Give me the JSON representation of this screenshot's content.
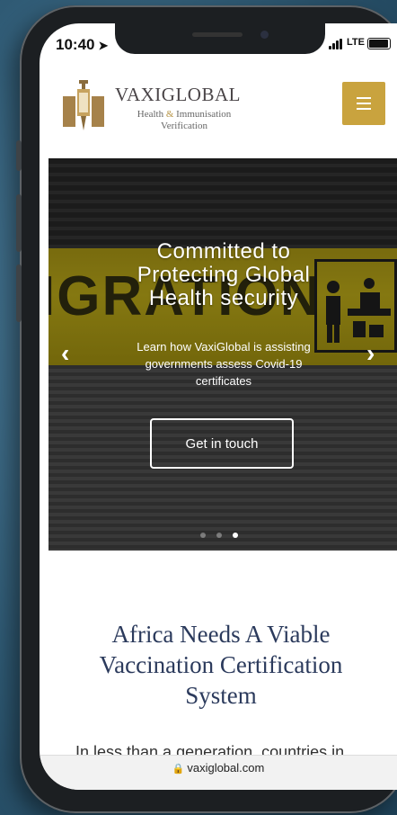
{
  "status_bar": {
    "time": "10:40",
    "network": "LTE"
  },
  "header": {
    "brand_name": "VAXIGLOBAL",
    "tagline_part1": "Health",
    "tagline_amp": "&",
    "tagline_part2": "Immunisation",
    "tagline_line2": "Verification"
  },
  "hero": {
    "title": "Committed to Protecting Global Health security",
    "subtitle": "Learn how VaxiGlobal is assisting governments assess Covid-19 certificates",
    "cta_label": "Get in touch",
    "sign_text": "IGRATION",
    "prev_label": "‹",
    "next_label": "›",
    "slide_count": 3,
    "active_slide": 3
  },
  "section": {
    "title": "Africa Needs A Viable Vaccination Certification System",
    "text": "In less than a generation, countries in"
  },
  "browser": {
    "url": "vaxiglobal.com"
  },
  "colors": {
    "accent": "#c9a33e",
    "heading": "#2b3a5c"
  },
  "icons": [
    "location-arrow-icon",
    "signal-icon",
    "battery-icon",
    "menu-icon",
    "chevron-left-icon",
    "chevron-right-icon",
    "lock-icon"
  ]
}
